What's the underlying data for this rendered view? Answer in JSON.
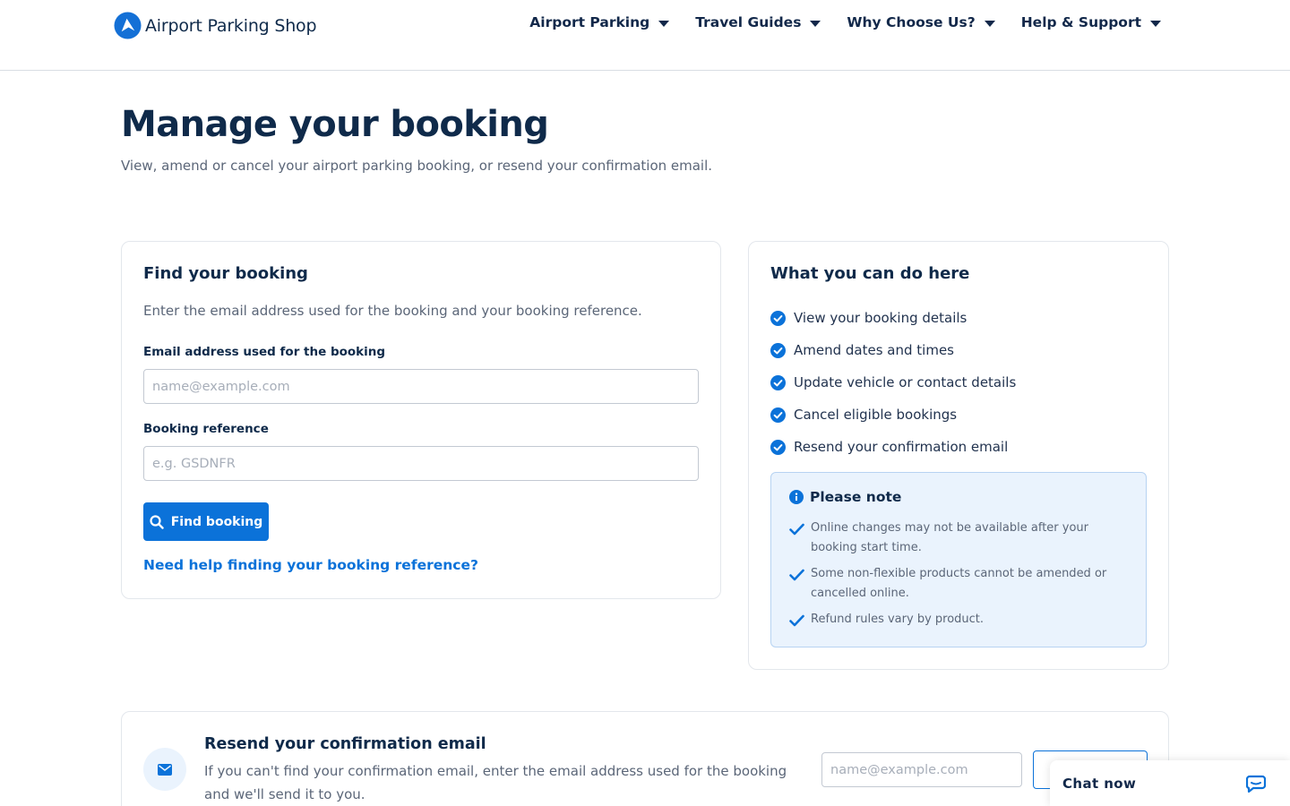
{
  "header": {
    "brand": "Airport Parking Shop",
    "nav": [
      {
        "label": "Airport Parking"
      },
      {
        "label": "Travel Guides"
      },
      {
        "label": "Why Choose Us?"
      },
      {
        "label": "Help & Support"
      }
    ]
  },
  "hero": {
    "title": "Manage your booking",
    "subtitle": "View, amend or cancel your airport parking booking, or resend your confirmation email."
  },
  "find_booking": {
    "title": "Find your booking",
    "description": "Enter the email address used for the booking and your booking reference.",
    "email_label": "Email address used for the booking",
    "email_placeholder": "name@example.com",
    "email_value": "",
    "reference_label": "Booking reference",
    "reference_placeholder": "e.g. GSDNFR",
    "reference_value": "",
    "button_label": "Find booking",
    "help_link": "Need help finding your booking reference?"
  },
  "info": {
    "title": "What you can do here",
    "items": [
      "View your booking details",
      "Amend dates and times",
      "Update vehicle or contact details",
      "Cancel eligible bookings",
      "Resend your confirmation email"
    ],
    "note": {
      "title": "Please note",
      "items": [
        "Online changes may not be available after your booking start time.",
        "Some non-flexible products cannot be amended or cancelled online.",
        "Refund rules vary by product."
      ]
    }
  },
  "resend": {
    "title": "Resend your confirmation email",
    "description": "If you can't find your confirmation email, enter the email address used for the booking and we'll send it to you.",
    "email_placeholder": "name@example.com",
    "button_label": ""
  },
  "chat": {
    "label": "Chat now"
  },
  "colors": {
    "primary": "#0b72d9",
    "heading": "#0f2a4a",
    "muted": "#5b6678",
    "note_bg": "#eaf3fd"
  },
  "icons": [
    "logo-plane-icon",
    "chevron-down-icon",
    "search-icon",
    "check-circle-icon",
    "info-icon",
    "check-icon",
    "envelope-icon",
    "chat-bubble-icon"
  ]
}
